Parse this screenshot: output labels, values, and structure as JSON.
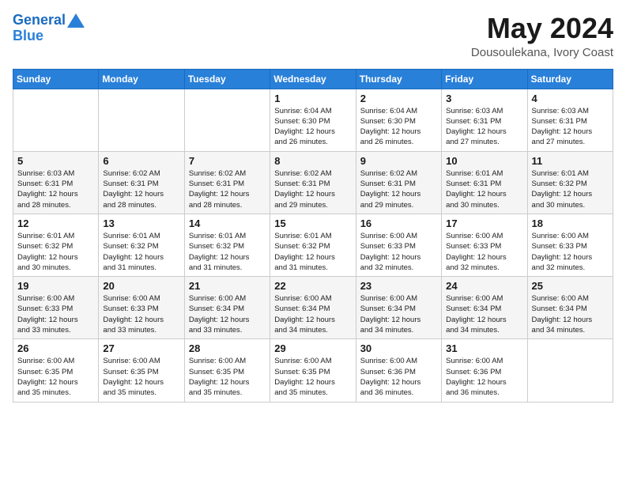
{
  "header": {
    "logo_line1": "General",
    "logo_line2": "Blue",
    "month": "May 2024",
    "location": "Dousoulekana, Ivory Coast"
  },
  "weekdays": [
    "Sunday",
    "Monday",
    "Tuesday",
    "Wednesday",
    "Thursday",
    "Friday",
    "Saturday"
  ],
  "weeks": [
    [
      {
        "day": "",
        "info": ""
      },
      {
        "day": "",
        "info": ""
      },
      {
        "day": "",
        "info": ""
      },
      {
        "day": "1",
        "info": "Sunrise: 6:04 AM\nSunset: 6:30 PM\nDaylight: 12 hours\nand 26 minutes."
      },
      {
        "day": "2",
        "info": "Sunrise: 6:04 AM\nSunset: 6:30 PM\nDaylight: 12 hours\nand 26 minutes."
      },
      {
        "day": "3",
        "info": "Sunrise: 6:03 AM\nSunset: 6:31 PM\nDaylight: 12 hours\nand 27 minutes."
      },
      {
        "day": "4",
        "info": "Sunrise: 6:03 AM\nSunset: 6:31 PM\nDaylight: 12 hours\nand 27 minutes."
      }
    ],
    [
      {
        "day": "5",
        "info": "Sunrise: 6:03 AM\nSunset: 6:31 PM\nDaylight: 12 hours\nand 28 minutes."
      },
      {
        "day": "6",
        "info": "Sunrise: 6:02 AM\nSunset: 6:31 PM\nDaylight: 12 hours\nand 28 minutes."
      },
      {
        "day": "7",
        "info": "Sunrise: 6:02 AM\nSunset: 6:31 PM\nDaylight: 12 hours\nand 28 minutes."
      },
      {
        "day": "8",
        "info": "Sunrise: 6:02 AM\nSunset: 6:31 PM\nDaylight: 12 hours\nand 29 minutes."
      },
      {
        "day": "9",
        "info": "Sunrise: 6:02 AM\nSunset: 6:31 PM\nDaylight: 12 hours\nand 29 minutes."
      },
      {
        "day": "10",
        "info": "Sunrise: 6:01 AM\nSunset: 6:31 PM\nDaylight: 12 hours\nand 30 minutes."
      },
      {
        "day": "11",
        "info": "Sunrise: 6:01 AM\nSunset: 6:32 PM\nDaylight: 12 hours\nand 30 minutes."
      }
    ],
    [
      {
        "day": "12",
        "info": "Sunrise: 6:01 AM\nSunset: 6:32 PM\nDaylight: 12 hours\nand 30 minutes."
      },
      {
        "day": "13",
        "info": "Sunrise: 6:01 AM\nSunset: 6:32 PM\nDaylight: 12 hours\nand 31 minutes."
      },
      {
        "day": "14",
        "info": "Sunrise: 6:01 AM\nSunset: 6:32 PM\nDaylight: 12 hours\nand 31 minutes."
      },
      {
        "day": "15",
        "info": "Sunrise: 6:01 AM\nSunset: 6:32 PM\nDaylight: 12 hours\nand 31 minutes."
      },
      {
        "day": "16",
        "info": "Sunrise: 6:00 AM\nSunset: 6:33 PM\nDaylight: 12 hours\nand 32 minutes."
      },
      {
        "day": "17",
        "info": "Sunrise: 6:00 AM\nSunset: 6:33 PM\nDaylight: 12 hours\nand 32 minutes."
      },
      {
        "day": "18",
        "info": "Sunrise: 6:00 AM\nSunset: 6:33 PM\nDaylight: 12 hours\nand 32 minutes."
      }
    ],
    [
      {
        "day": "19",
        "info": "Sunrise: 6:00 AM\nSunset: 6:33 PM\nDaylight: 12 hours\nand 33 minutes."
      },
      {
        "day": "20",
        "info": "Sunrise: 6:00 AM\nSunset: 6:33 PM\nDaylight: 12 hours\nand 33 minutes."
      },
      {
        "day": "21",
        "info": "Sunrise: 6:00 AM\nSunset: 6:34 PM\nDaylight: 12 hours\nand 33 minutes."
      },
      {
        "day": "22",
        "info": "Sunrise: 6:00 AM\nSunset: 6:34 PM\nDaylight: 12 hours\nand 34 minutes."
      },
      {
        "day": "23",
        "info": "Sunrise: 6:00 AM\nSunset: 6:34 PM\nDaylight: 12 hours\nand 34 minutes."
      },
      {
        "day": "24",
        "info": "Sunrise: 6:00 AM\nSunset: 6:34 PM\nDaylight: 12 hours\nand 34 minutes."
      },
      {
        "day": "25",
        "info": "Sunrise: 6:00 AM\nSunset: 6:34 PM\nDaylight: 12 hours\nand 34 minutes."
      }
    ],
    [
      {
        "day": "26",
        "info": "Sunrise: 6:00 AM\nSunset: 6:35 PM\nDaylight: 12 hours\nand 35 minutes."
      },
      {
        "day": "27",
        "info": "Sunrise: 6:00 AM\nSunset: 6:35 PM\nDaylight: 12 hours\nand 35 minutes."
      },
      {
        "day": "28",
        "info": "Sunrise: 6:00 AM\nSunset: 6:35 PM\nDaylight: 12 hours\nand 35 minutes."
      },
      {
        "day": "29",
        "info": "Sunrise: 6:00 AM\nSunset: 6:35 PM\nDaylight: 12 hours\nand 35 minutes."
      },
      {
        "day": "30",
        "info": "Sunrise: 6:00 AM\nSunset: 6:36 PM\nDaylight: 12 hours\nand 36 minutes."
      },
      {
        "day": "31",
        "info": "Sunrise: 6:00 AM\nSunset: 6:36 PM\nDaylight: 12 hours\nand 36 minutes."
      },
      {
        "day": "",
        "info": ""
      }
    ]
  ]
}
